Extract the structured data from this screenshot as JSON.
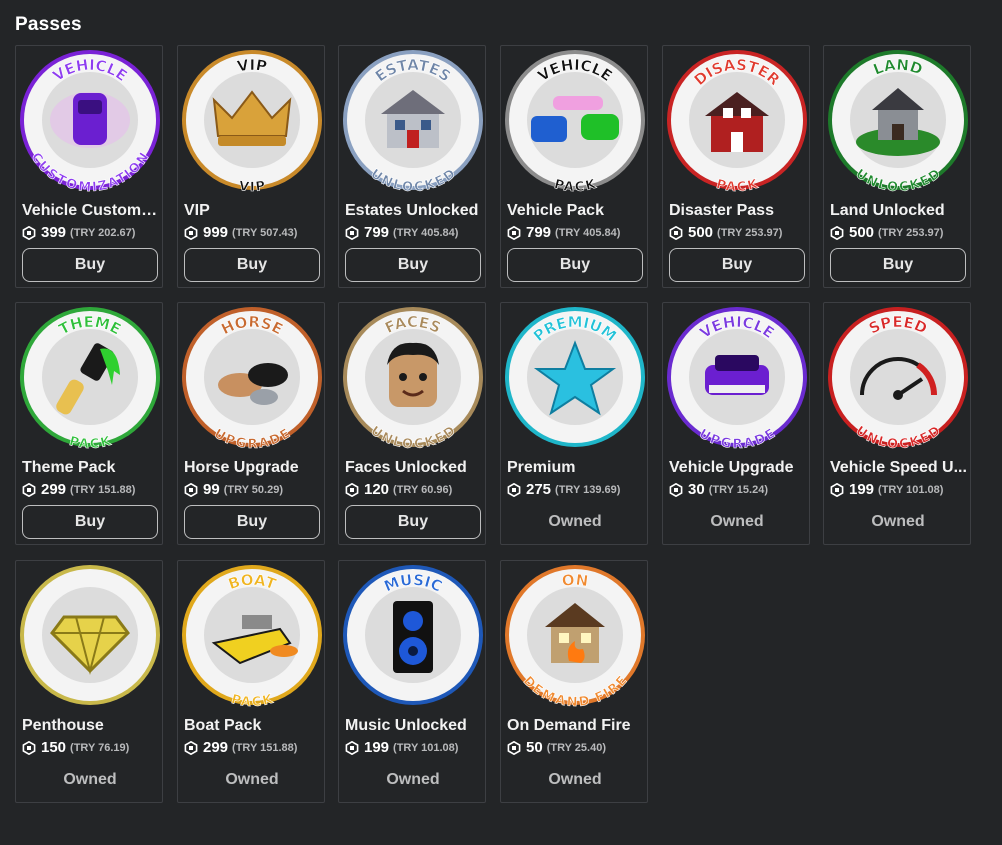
{
  "page": {
    "title": "Passes"
  },
  "passes": [
    {
      "name": "Vehicle Customiz...",
      "price": "399",
      "try": "(TRY 202.67)",
      "action": "Buy",
      "badge_top": "VEHICLE",
      "badge_bottom": "CUSTOMIZATION",
      "ring_color": "#7a22d6",
      "text_color": "#8e3df0",
      "icon": "purple-car-icon"
    },
    {
      "name": "VIP",
      "price": "999",
      "try": "(TRY 507.43)",
      "action": "Buy",
      "badge_top": "VIP",
      "badge_bottom": "VIP",
      "ring_color": "#c98a2a",
      "text_color": "#111111",
      "icon": "gold-crown-icon"
    },
    {
      "name": "Estates Unlocked",
      "price": "799",
      "try": "(TRY 405.84)",
      "action": "Buy",
      "badge_top": "ESTATES",
      "badge_bottom": "UNLOCKED",
      "ring_color": "#8aa0c0",
      "text_color": "#6f86a8",
      "icon": "house-icon"
    },
    {
      "name": "Vehicle Pack",
      "price": "799",
      "try": "(TRY 405.84)",
      "action": "Buy",
      "badge_top": "VEHICLE",
      "badge_bottom": "PACK",
      "ring_color": "#8c8c8c",
      "text_color": "#111111",
      "icon": "cars-icon"
    },
    {
      "name": "Disaster Pass",
      "price": "500",
      "try": "(TRY 253.97)",
      "action": "Buy",
      "badge_top": "DISASTER",
      "badge_bottom": "PACK",
      "ring_color": "#c92424",
      "text_color": "#e03a2e",
      "icon": "broken-house-icon"
    },
    {
      "name": "Land Unlocked",
      "price": "500",
      "try": "(TRY 253.97)",
      "action": "Buy",
      "badge_top": "LAND",
      "badge_bottom": "UNLOCKED",
      "ring_color": "#1d7a2a",
      "text_color": "#1f8a2e",
      "icon": "land-house-icon"
    },
    {
      "name": "Theme Pack",
      "price": "299",
      "try": "(TRY 151.88)",
      "action": "Buy",
      "badge_top": "THEME",
      "badge_bottom": "PACK",
      "ring_color": "#2fa83a",
      "text_color": "#2fbf3a",
      "icon": "paintbrush-icon"
    },
    {
      "name": "Horse Upgrade",
      "price": "99",
      "try": "(TRY 50.29)",
      "action": "Buy",
      "badge_top": "HORSE",
      "badge_bottom": "UPGRADE",
      "ring_color": "#c0602a",
      "text_color": "#c86a30",
      "icon": "horses-icon"
    },
    {
      "name": "Faces Unlocked",
      "price": "120",
      "try": "(TRY 60.96)",
      "action": "Buy",
      "badge_top": "FACES",
      "badge_bottom": "UNLOCKED",
      "ring_color": "#a78a5a",
      "text_color": "#a98a5c",
      "icon": "face-icon"
    },
    {
      "name": "Premium",
      "price": "275",
      "try": "(TRY 139.69)",
      "action": "Owned",
      "badge_top": "PREMIUM",
      "badge_bottom": "",
      "ring_color": "#1fb6c9",
      "text_color": "#22c2d8",
      "icon": "star-icon"
    },
    {
      "name": "Vehicle Upgrade",
      "price": "30",
      "try": "(TRY 15.24)",
      "action": "Owned",
      "badge_top": "VEHICLE",
      "badge_bottom": "UPGRADE",
      "ring_color": "#6a2bd0",
      "text_color": "#7b3be0",
      "icon": "purple-car-front-icon"
    },
    {
      "name": "Vehicle Speed U...",
      "price": "199",
      "try": "(TRY 101.08)",
      "action": "Owned",
      "badge_top": "SPEED",
      "badge_bottom": "UNLOCKED",
      "ring_color": "#c82020",
      "text_color": "#d82828",
      "icon": "speedometer-icon"
    },
    {
      "name": "Penthouse",
      "price": "150",
      "try": "(TRY 76.19)",
      "action": "Owned",
      "badge_top": "",
      "badge_bottom": "",
      "ring_color": "#c8b84a",
      "text_color": "#d6c24a",
      "icon": "diamond-icon"
    },
    {
      "name": "Boat Pack",
      "price": "299",
      "try": "(TRY 151.88)",
      "action": "Owned",
      "badge_top": "BOAT",
      "badge_bottom": "PACK",
      "ring_color": "#e0a81c",
      "text_color": "#f0b41f",
      "icon": "boat-icon"
    },
    {
      "name": "Music Unlocked",
      "price": "199",
      "try": "(TRY 101.08)",
      "action": "Owned",
      "badge_top": "MUSIC",
      "badge_bottom": "",
      "ring_color": "#1e58b8",
      "text_color": "#2a6ad6",
      "icon": "speaker-icon"
    },
    {
      "name": "On Demand Fire",
      "price": "50",
      "try": "(TRY 25.40)",
      "action": "Owned",
      "badge_top": "ON",
      "badge_bottom": "DEMAND FIRE",
      "ring_color": "#e0782a",
      "text_color": "#f08a30",
      "icon": "burning-house-icon"
    }
  ]
}
